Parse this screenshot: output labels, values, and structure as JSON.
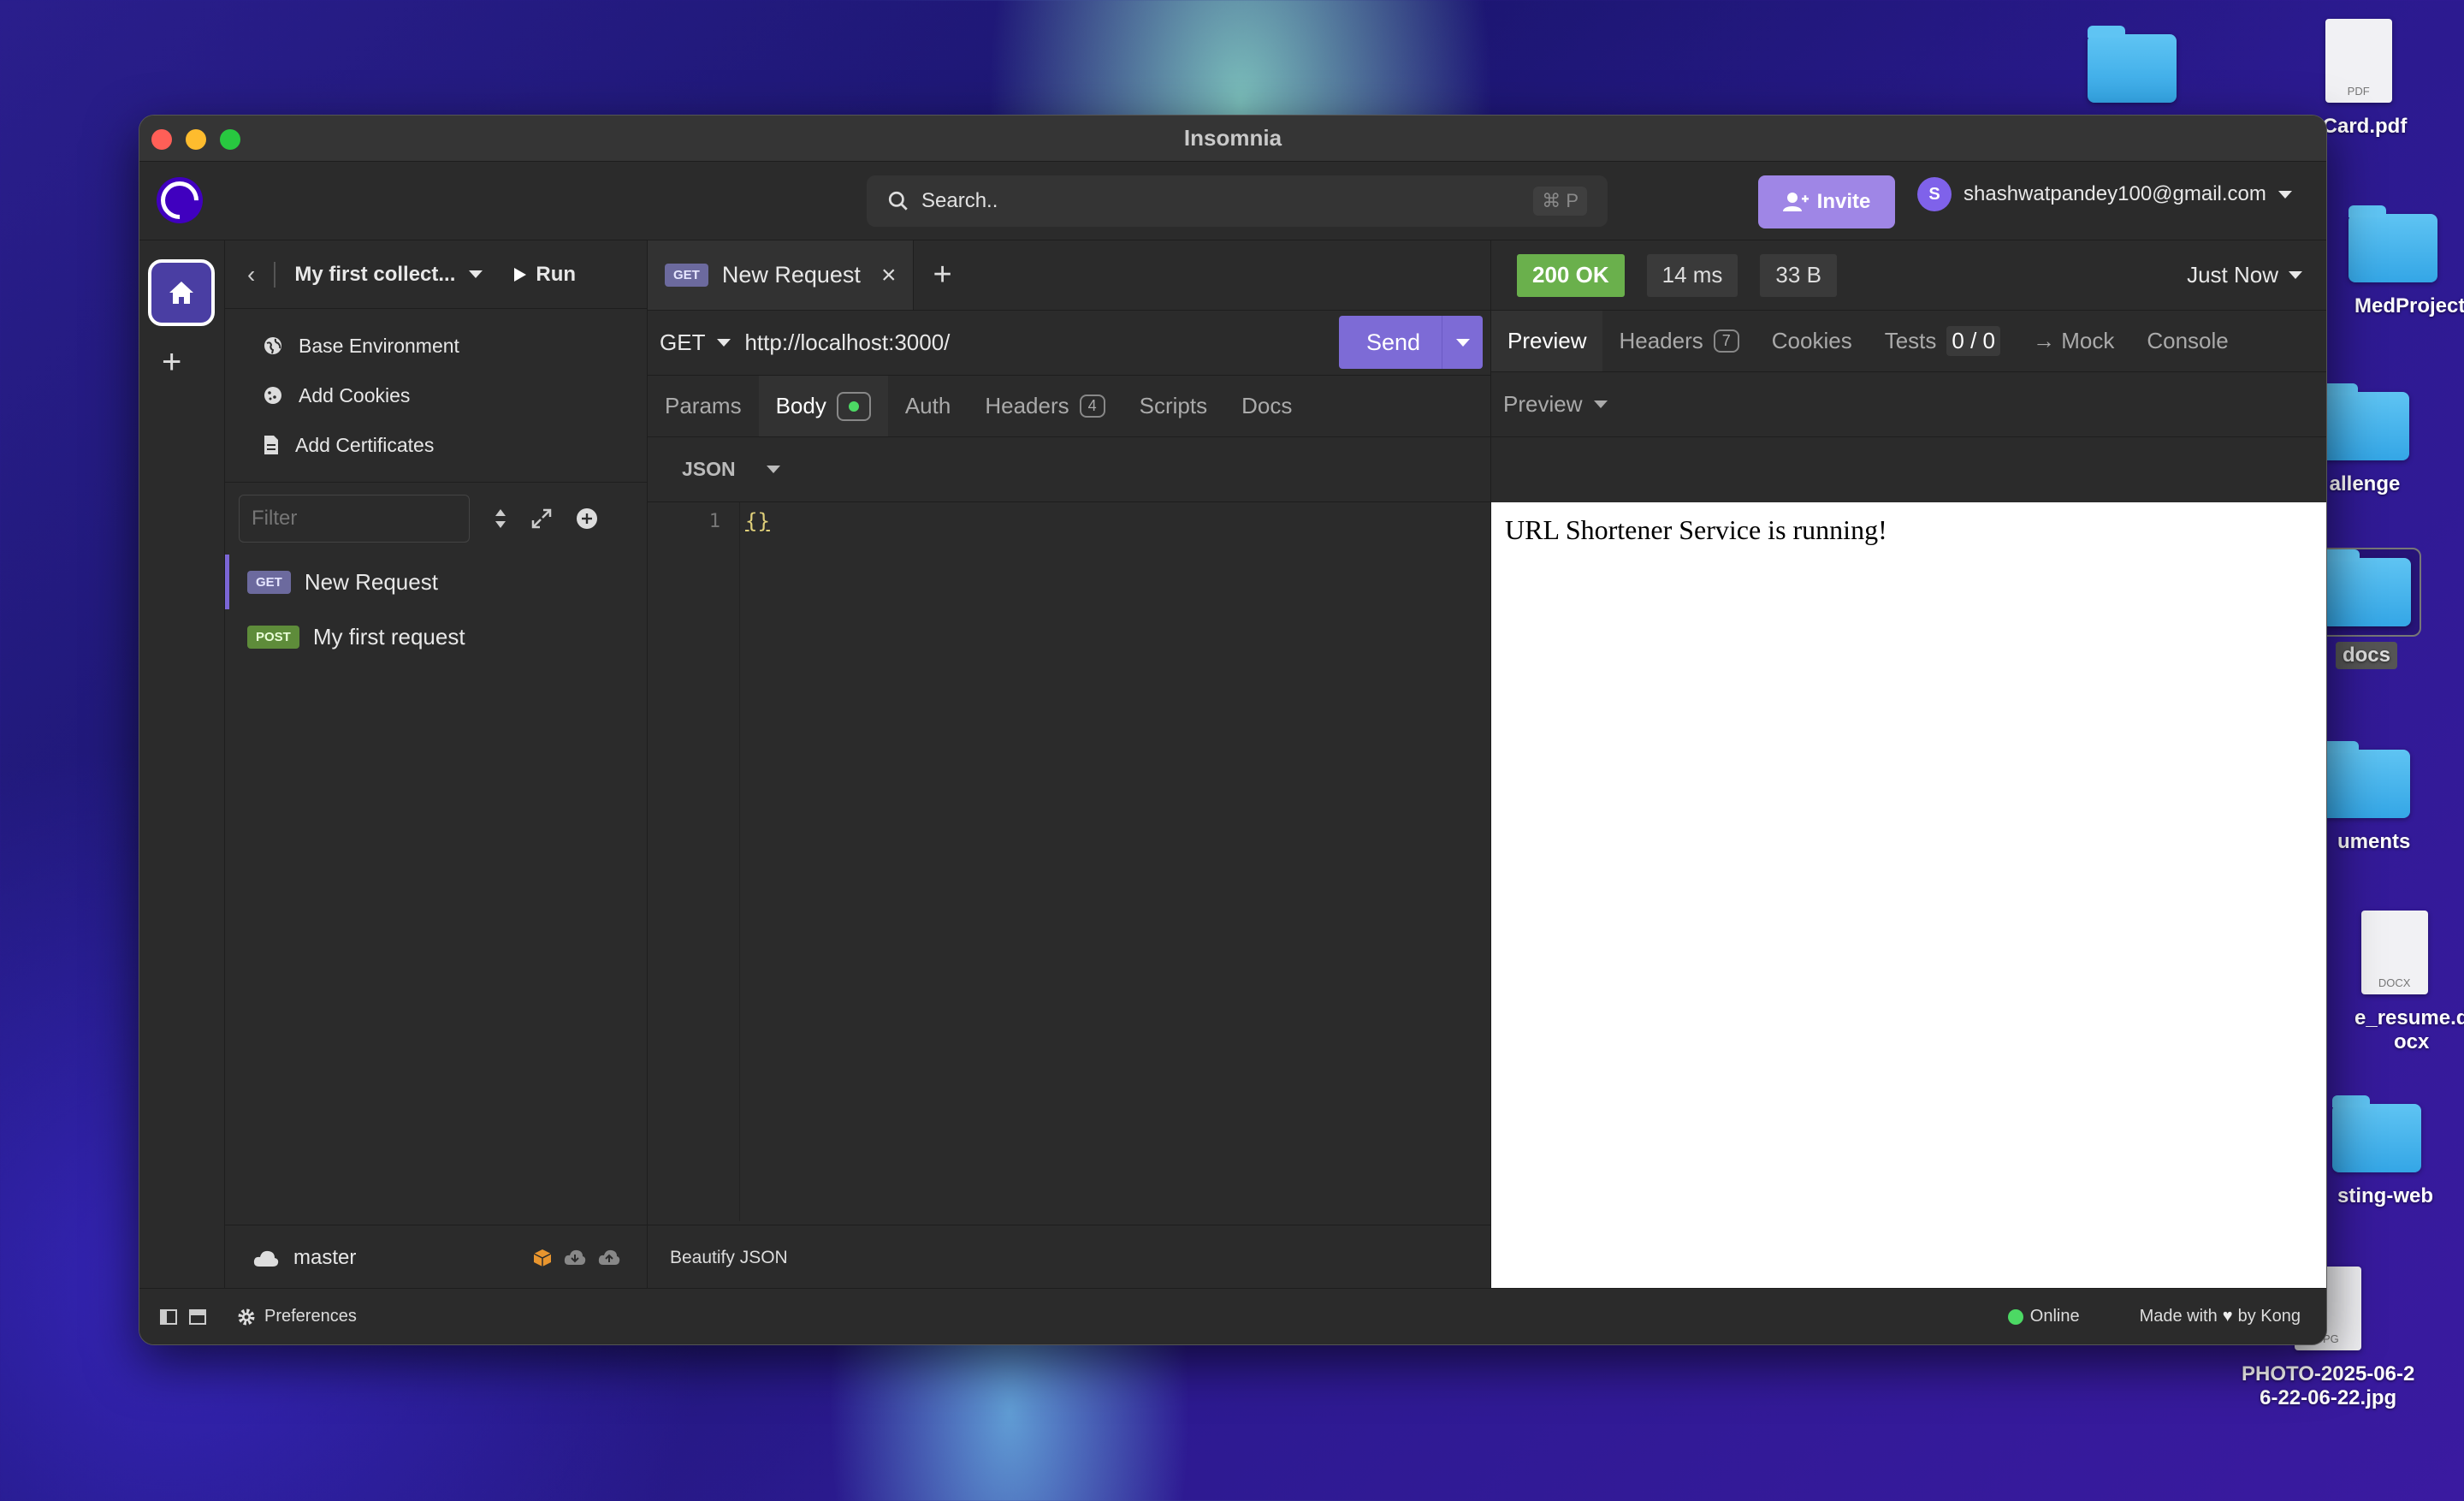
{
  "desktop": {
    "items": [
      {
        "label": ""
      },
      {
        "label": ": Card.pdf",
        "file_type": "PDF"
      },
      {
        "label": "MedProject"
      },
      {
        "label": "allenge"
      },
      {
        "label": "docs"
      },
      {
        "label": "uments"
      },
      {
        "label": "e_resume.d\nocx",
        "file_type": "DOCX"
      },
      {
        "label": "sting-web"
      },
      {
        "label": "PHOTO-2025-06-2\n6-22-06-22.jpg",
        "file_type": "JPG"
      }
    ]
  },
  "window": {
    "title": "Insomnia"
  },
  "topbar": {
    "search_placeholder": "Search..",
    "search_shortcut": "⌘ P",
    "invite_label": "Invite",
    "user_initial": "S",
    "user_email": "shashwatpandey100@gmail.com"
  },
  "sidebar": {
    "collection_name": "My first collect...",
    "run_label": "Run",
    "menu": [
      {
        "label": "Base Environment",
        "icon": "globe-icon"
      },
      {
        "label": "Add Cookies",
        "icon": "cookie-icon"
      },
      {
        "label": "Add Certificates",
        "icon": "file-icon"
      }
    ],
    "filter_placeholder": "Filter",
    "requests": [
      {
        "method": "GET",
        "name": "New Request",
        "active": true
      },
      {
        "method": "POST",
        "name": "My first request",
        "active": false
      }
    ],
    "branch": "master"
  },
  "request": {
    "tab_method": "GET",
    "tab_name": "New Request",
    "method": "GET",
    "url": "http://localhost:3000/",
    "send_label": "Send",
    "tabs": [
      {
        "label": "Params"
      },
      {
        "label": "Body",
        "selected": true
      },
      {
        "label": "Auth"
      },
      {
        "label": "Headers",
        "count": "4"
      },
      {
        "label": "Scripts"
      },
      {
        "label": "Docs"
      }
    ],
    "body_type": "JSON",
    "line_number": "1",
    "code": "{}",
    "footer_action": "Beautify JSON"
  },
  "response": {
    "status": "200 OK",
    "time": "14 ms",
    "size": "33 B",
    "timestamp": "Just Now",
    "tabs": [
      {
        "label": "Preview",
        "selected": true
      },
      {
        "label": "Headers",
        "count": "7"
      },
      {
        "label": "Cookies"
      },
      {
        "label": "Tests",
        "count": "0 / 0"
      },
      {
        "label": "→ Mock"
      },
      {
        "label": "Console"
      }
    ],
    "preview_mode": "Preview",
    "body_text": "URL Shortener Service is running!"
  },
  "footer": {
    "preferences_label": "Preferences",
    "online_label": "Online",
    "made_with_prefix": "Made with",
    "made_with_suffix": "by Kong"
  },
  "colors": {
    "accent": "#7d6bd6",
    "status_ok": "#6ab04c",
    "get_badge": "#6c6a9e",
    "post_badge": "#5e8c3a",
    "online": "#4cd964"
  }
}
